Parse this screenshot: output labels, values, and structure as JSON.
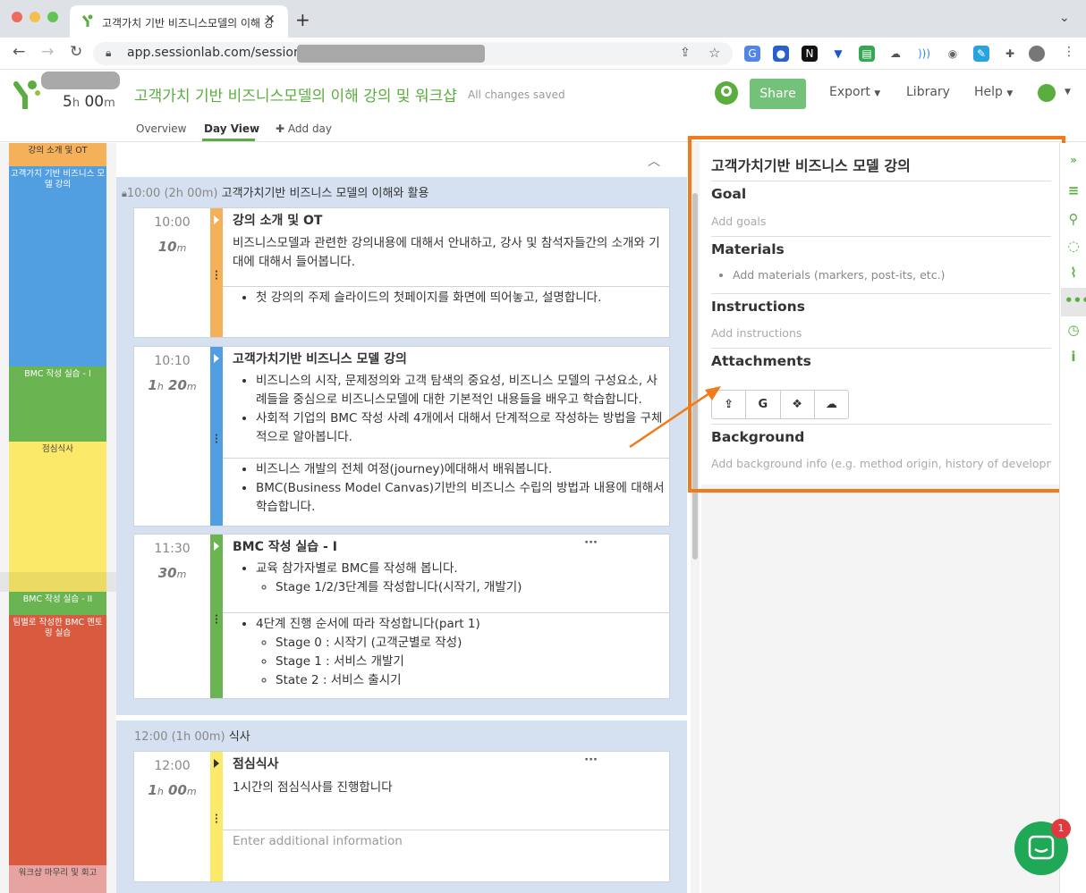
{
  "browser": {
    "tab_title": "고객가치 기반 비즈니스모델의 이해 강",
    "url": "app.sessionlab.com/sessions/"
  },
  "app": {
    "duration_h": "5",
    "duration_h_unit": "h",
    "duration_m": "00",
    "duration_m_unit": "m",
    "session_title": "고객가치 기반 비즈니스모델의 이해 강의 및 워크샵",
    "save_status": "All changes saved",
    "share_label": "Share",
    "menu": [
      "Export",
      "Library",
      "Help"
    ],
    "subnav": {
      "overview": "Overview",
      "day_view": "Day View",
      "add_day": "Add day"
    },
    "accent": "#5aad3e"
  },
  "timeline": [
    {
      "label": "강의 소개 및 OT",
      "color": "#f5b05a"
    },
    {
      "label": "고객가치 기반 비즈니스 모델 강의",
      "color": "#519ee0"
    },
    {
      "label": "BMC 작성 실습 - I",
      "color": "#6ab552"
    },
    {
      "label": "점심식사",
      "color": "#fbe96a"
    },
    {
      "label": "BMC 작성 실습 - II",
      "color": "#6ab552"
    },
    {
      "label": "팀별로 작성한 BMC 멘토링 실습",
      "color": "#d95a3f"
    },
    {
      "label": "워크샵 마무리 및 회고",
      "color": "#e6a3a0"
    }
  ],
  "groups": [
    {
      "time": "10:00",
      "duration": "(2h 00m)",
      "title": "고객가치기반 비즈니스 모델의 이해와 활용"
    },
    {
      "time": "12:00",
      "duration": "(1h 00m)",
      "title": "식사"
    }
  ],
  "cards": [
    {
      "time": "10:00",
      "dur_h": "",
      "dur_h_unit": "",
      "dur_m": "10",
      "dur_m_unit": "m",
      "title": "강의 소개 및 OT",
      "desc": "비즈니스모델과 관련한 강의내용에 대해서 안내하고, 강사 및 참석자들간의 소개와 기대에 대해서 들어봅니다.",
      "notes": [
        "첫 강의의 주제 슬라이드의 첫페이지를 화면에 띄어놓고, 설명합니다."
      ]
    },
    {
      "time": "10:10",
      "dur_h": "1",
      "dur_h_unit": "h",
      "dur_m": "20",
      "dur_m_unit": "m",
      "title": "고객가치기반 비즈니스 모델 강의",
      "bullets": [
        "비즈니스의 시작, 문제정의와 고객 탐색의 중요성, 비즈니스 모델의 구성요소, 사례들을 중심으로 비즈니스모델에 대한 기본적인 내용들을 배우고 학습합니다.",
        "사회적 기업의 BMC 작성 사례 4개에서 대해서 단계적으로 작성하는 방법을 구체적으로 알아봅니다."
      ],
      "notes": [
        "비즈니스 개발의 전체 여정(journey)에대해서 배워봅니다.",
        "BMC(Business Model Canvas)기반의 비즈니스 수립의 방법과 내용에 대해서 학습합니다."
      ]
    },
    {
      "time": "11:30",
      "dur_h": "",
      "dur_h_unit": "",
      "dur_m": "30",
      "dur_m_unit": "m",
      "title": "BMC 작성 실습 - I",
      "bullet": "교육 참가자별로 BMC를 작성해 봅니다.",
      "sub": "Stage 1/2/3단계를 작성합니다(시작기, 개발기)",
      "note": "4단계 진행 순서에 따라 작성합니다(part 1)",
      "note_subs": [
        "Stage 0 : 시작기 (고객군별로 작성)",
        "Stage 1 : 서비스 개발기",
        "State 2 : 서비스 출시기"
      ]
    },
    {
      "time": "12:00",
      "dur_h": "1",
      "dur_h_unit": "h",
      "dur_m": "00",
      "dur_m_unit": "m",
      "title": "점심식사",
      "desc": "1시간의 점심식사를 진행합니다",
      "placeholder": "Enter additional information"
    }
  ],
  "panel": {
    "title": "고객가치기반 비즈니스 모델 강의",
    "goal_label": "Goal",
    "goal_placeholder": "Add goals",
    "materials_label": "Materials",
    "materials_placeholder": "Add materials (markers, post-its, etc.)",
    "instructions_label": "Instructions",
    "instructions_placeholder": "Add instructions",
    "attachments_label": "Attachments",
    "attachment_buttons": [
      "upload-icon",
      "G",
      "dropbox-icon",
      "cloud-icon"
    ],
    "background_label": "Background",
    "background_placeholder": "Add background info (e.g. method origin, history of developme"
  },
  "chat_badge": "1"
}
